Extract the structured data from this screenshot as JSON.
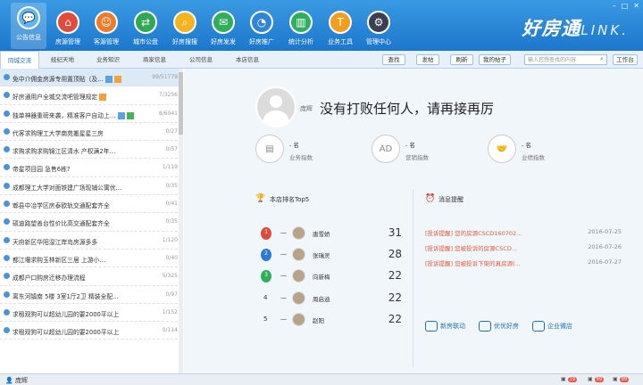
{
  "nav": {
    "items": [
      {
        "label": "公告信息",
        "icon": "chat-bubble-icon",
        "color": "#5fb6f2",
        "active": true
      },
      {
        "label": "房源管理",
        "icon": "house-icon",
        "color": "#e24b3c"
      },
      {
        "label": "客源管理",
        "icon": "person-icon",
        "color": "#ee7a2b"
      },
      {
        "label": "城市公盘",
        "icon": "share-icon",
        "color": "#31a853"
      },
      {
        "label": "好房搜搜",
        "icon": "search-doc-icon",
        "color": "#f2b51f"
      },
      {
        "label": "好房发发",
        "icon": "mail-icon",
        "color": "#2fae5b"
      },
      {
        "label": "好房推广",
        "icon": "megaphone-icon",
        "color": "#2f86d6"
      },
      {
        "label": "统计分析",
        "icon": "chart-icon",
        "color": "#2fae5b"
      },
      {
        "label": "业务工具",
        "icon": "tools-icon",
        "color": "#f29f1f"
      },
      {
        "label": "管理中心",
        "icon": "gear-icon",
        "color": "#3a3f52"
      }
    ],
    "brand": "好房通",
    "brand_en": "LINK."
  },
  "tabs": [
    "同城交流",
    "经纪天地",
    "业务知识",
    "商家信息",
    "公司信息",
    "本店信息"
  ],
  "toolbar": {
    "buttons": [
      "查找",
      "发帖",
      "刷新",
      "我的帖子"
    ],
    "search_placeholder": "输入您想查找的内容",
    "workbench": "工作台"
  },
  "posts": [
    {
      "title": "免中介佣金房源专用置顶贴（及…",
      "count": "99/51779",
      "tags": [
        "img",
        "fire"
      ]
    },
    {
      "title": "好房通用户全城交流吧管理规定",
      "count": "7/3256",
      "tags": [
        "hot"
      ]
    },
    {
      "title": "独单神器重磅来袭，精准客户自动上…",
      "count": "8/6041",
      "tags": [
        "img",
        "new"
      ]
    },
    {
      "title": "代客求购理工大学南苑搬星星三房",
      "count": "0/27",
      "tags": []
    },
    {
      "title": "求购求购求购锦江区清水  产权满2年…",
      "count": "0/57",
      "tags": []
    },
    {
      "title": "帝星项目园 急售6栋?",
      "count": "1/119",
      "tags": []
    },
    {
      "title": "成都理工大学对面铁建广场现铺公寓优…",
      "count": "0/35",
      "tags": []
    },
    {
      "title": "郫县中冶学区房泰欧轨交通配套齐全",
      "count": "0/41",
      "tags": []
    },
    {
      "title": "硕迪路望善台性价比高交通配套齐全",
      "count": "0/35",
      "tags": []
    },
    {
      "title": "天府新区华阳湿江岸岛房源多多",
      "count": "1/120",
      "tags": []
    },
    {
      "title": "都江堰求购玉林新区三居  上游小…",
      "count": "0/40",
      "tags": []
    },
    {
      "title": "成都户口购房迁移办理流程",
      "count": "5/325",
      "tags": []
    },
    {
      "title": "离东河镇南  5楼  3室1厅2卫 精装全配…",
      "count": "0/97",
      "tags": []
    },
    {
      "title": "求租观狗可以超幼儿园的要2000平以上",
      "count": "1/152",
      "tags": []
    },
    {
      "title": "求租观狗可以超幼儿园的要2000平以上",
      "count": "0/114",
      "tags": []
    }
  ],
  "profile": {
    "name": "庞辉",
    "motto": "没有打败任何人，请再接再厉",
    "stats": [
      {
        "value": "- 名",
        "label": "业务指数",
        "icon": "document-icon"
      },
      {
        "value": "- 名",
        "label": "营销指数",
        "icon": "ad-icon"
      },
      {
        "value": "- 名",
        "label": "业绩指数",
        "icon": "handshake-icon"
      }
    ]
  },
  "ranking": {
    "title": "本店排名Top5",
    "rows": [
      {
        "rank": "1",
        "name": "唐雪娇",
        "score": "31",
        "medal": "#e04a3a"
      },
      {
        "rank": "2",
        "name": "张瑞灵",
        "score": "28",
        "medal": "#2b7bd6"
      },
      {
        "rank": "3",
        "name": "向新梅",
        "score": "22",
        "medal": "#2fae5b"
      },
      {
        "rank": "4",
        "name": "周启迪",
        "score": "22",
        "medal": ""
      },
      {
        "rank": "5",
        "name": "赵阳",
        "score": "22",
        "medal": ""
      }
    ]
  },
  "messages": {
    "title": "消息提醒",
    "rows": [
      {
        "text": "[投诉提醒] 您的房源CSCD160702...",
        "date": "2016-07-25"
      },
      {
        "text": "[投诉提醒] 您被投诉的房源CSCD...",
        "date": "2016-07-26"
      },
      {
        "text": "[投诉提醒] 您被投诉下架的真房源(...",
        "date": "2016-07-27"
      }
    ]
  },
  "quick_links": [
    "新房联动",
    "优优好房",
    "企业微店"
  ],
  "status": {
    "user": "庞辉",
    "badges": [
      "19",
      "99",
      "99"
    ]
  }
}
